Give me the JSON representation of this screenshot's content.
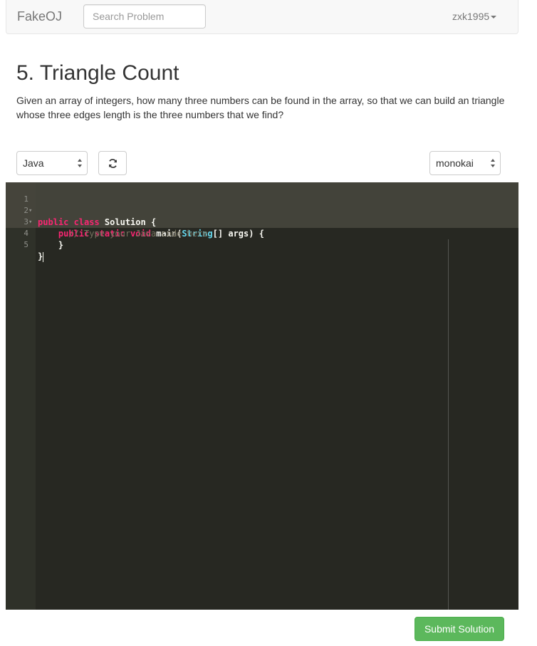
{
  "navbar": {
    "brand": "FakeOJ",
    "search_placeholder": "Search Problem",
    "user": "zxk1995"
  },
  "problem": {
    "title": "5. Triangle Count",
    "description": "Given an array of integers, how many three numbers can be found in the array, so that we can build an triangle whose three edges length is the three numbers that we find?"
  },
  "toolbar": {
    "language": "Java",
    "reset_icon": "refresh-icon",
    "theme": "monokai"
  },
  "editor": {
    "line_numbers": [
      "1",
      "2",
      "3",
      "4",
      "5"
    ],
    "lines": {
      "l1_kw": "public class ",
      "l1_rest": "Solution {",
      "l2_indent": "    ",
      "l2_kw": "public static void ",
      "l2_main": "main(",
      "l2_type": "String",
      "l2_brackets": "[]",
      "l2_rest": " args) {",
      "l3": "      // Type your Java code here",
      "l4": "    }",
      "l5": "}"
    },
    "colors": {
      "background": "#272822",
      "keyword": "#f92672",
      "type": "#66d9ef",
      "comment": "#75715e"
    }
  },
  "submit_label": "Submit Solution",
  "colors": {
    "submit": "#5cb85c"
  }
}
